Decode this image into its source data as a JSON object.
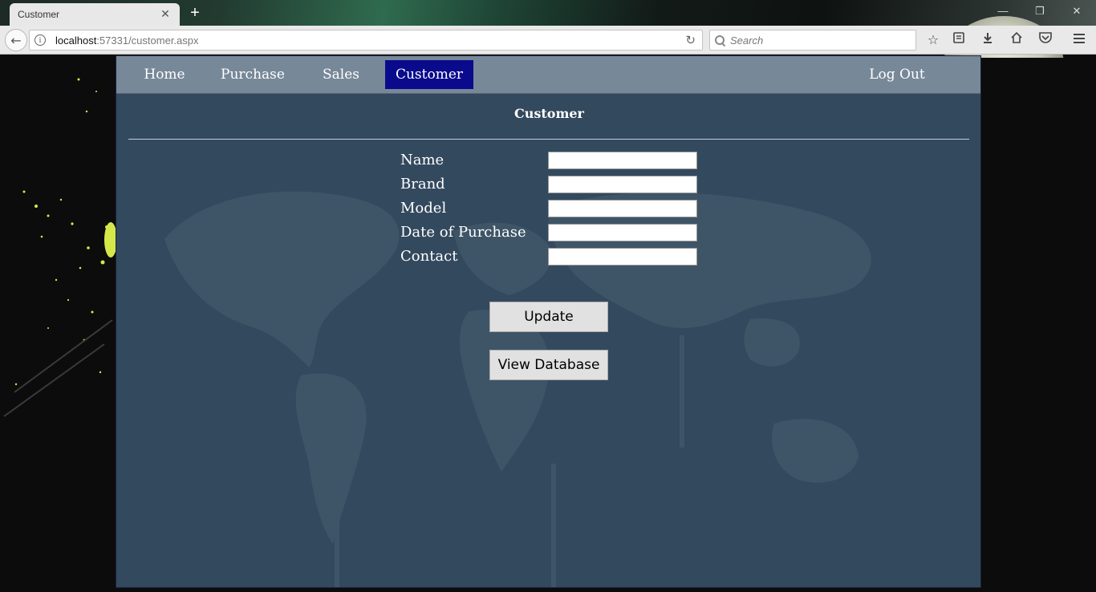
{
  "browser": {
    "tab_title": "Customer",
    "tab_close": "✕",
    "new_tab": "+",
    "window_controls": {
      "minimize": "—",
      "restore": "❐",
      "close": "✕"
    },
    "url_host": "localhost",
    "url_rest": ":57331/customer.aspx",
    "search_placeholder": "Search",
    "icons": [
      "bookmark-star-icon",
      "reading-list-icon",
      "download-icon",
      "home-icon",
      "pocket-icon",
      "menu-icon"
    ]
  },
  "site": {
    "nav": {
      "home": "Home",
      "purchase": "Purchase",
      "sales": "Sales",
      "customer": "Customer",
      "logout": "Log Out",
      "active": "Customer"
    },
    "title": "Customer",
    "form": {
      "name_label": "Name",
      "brand_label": "Brand",
      "model_label": "Model",
      "date_label": "Date of Purchase",
      "contact_label": "Contact",
      "name_value": "",
      "brand_value": "",
      "model_value": "",
      "date_value": "",
      "contact_value": ""
    },
    "update_button": "Update",
    "view_db_button": "View Database",
    "colors": {
      "nav_bg": "#778899",
      "nav_active": "#0a0a8c",
      "content_bg": "#33495e",
      "page_bg": "#0c0c0c",
      "splatter": "#d4e84a"
    }
  }
}
